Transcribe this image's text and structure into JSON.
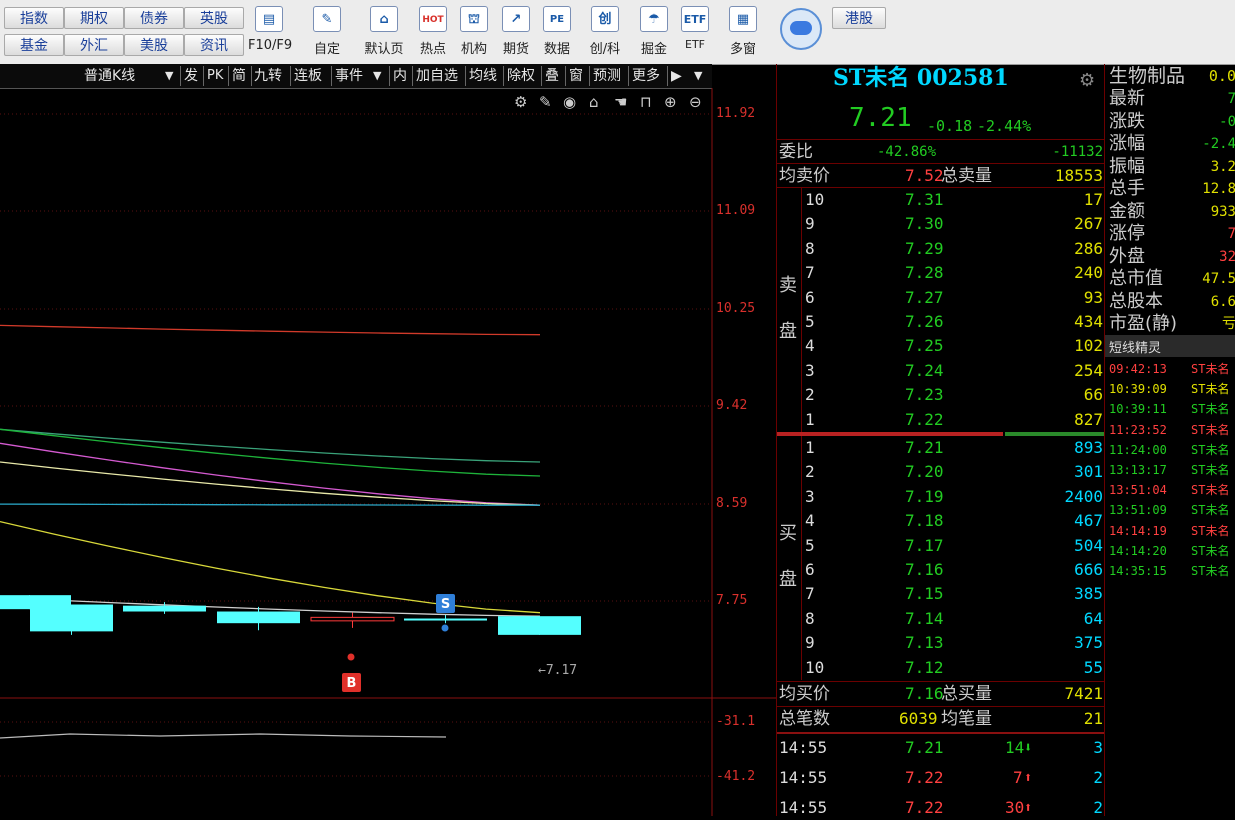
{
  "toolbar": {
    "text_buttons": [
      "指数",
      "期权",
      "债券",
      "英股",
      "基金",
      "外汇",
      "美股",
      "资讯"
    ],
    "icon_buttons": [
      {
        "label": "F10/F9",
        "icon": "f10-icon"
      },
      {
        "label": "自定",
        "icon": "custom-icon"
      },
      {
        "label": "默认页",
        "icon": "home-l2-icon"
      },
      {
        "label": "热点",
        "icon": "hot-icon",
        "glyph": "HOT"
      },
      {
        "label": "机构",
        "icon": "institution-icon"
      },
      {
        "label": "期货",
        "icon": "futures-icon"
      },
      {
        "label": "数据",
        "icon": "pe-data-icon",
        "glyph": "PE"
      },
      {
        "label": "创/科",
        "icon": "chuang-icon",
        "glyph": "创"
      },
      {
        "label": "掘金",
        "icon": "dig-gold-icon"
      },
      {
        "label": "ETF",
        "icon": "etf-icon",
        "glyph": "ETF"
      },
      {
        "label": "多窗",
        "icon": "multi-window-icon"
      }
    ],
    "hk_button": "港股"
  },
  "chart_toolbar": {
    "items": [
      "普通K线",
      "发",
      "PK",
      "简",
      "九转",
      "连板",
      "事件",
      "内",
      "加自选",
      "均线",
      "除权",
      "叠",
      "窗",
      "预测",
      "更多"
    ]
  },
  "chart_data": {
    "type": "candlestick",
    "y_ticks": [
      "11.92",
      "11.09",
      "10.25",
      "9.42",
      "8.59",
      "7.75"
    ],
    "indicator_ticks": [
      "-31.1",
      "-41.2"
    ],
    "last_price_label": "←7.17",
    "markers": [
      "S",
      "B"
    ],
    "ylim": [
      7.0,
      12.0
    ],
    "candles": [
      {
        "open": 7.8,
        "close": 7.68,
        "high": 7.8,
        "low": 7.68
      },
      {
        "open": 7.72,
        "close": 7.49,
        "high": 7.72,
        "low": 7.46
      },
      {
        "open": 7.71,
        "close": 7.66,
        "high": 7.74,
        "low": 7.64
      },
      {
        "open": 7.66,
        "close": 7.56,
        "high": 7.7,
        "low": 7.5
      },
      {
        "open": 7.58,
        "close": 7.61,
        "high": 7.65,
        "low": 7.52
      },
      {
        "open": 7.6,
        "close": 7.59,
        "high": 7.63,
        "low": 7.56
      },
      {
        "open": 7.62,
        "close": 7.46,
        "high": 7.62,
        "low": 7.46
      }
    ],
    "ma_lines": [
      {
        "color": "#d13a2a",
        "from": 10.11,
        "to": 10.03
      },
      {
        "color": "#3aa37a",
        "from": 9.22,
        "to": 8.94
      },
      {
        "color": "#1eb33a",
        "from": 9.22,
        "to": 8.82
      },
      {
        "color": "#d45ad0",
        "from": 9.1,
        "to": 8.57
      },
      {
        "color": "#e9e9a9",
        "from": 8.94,
        "to": 8.57
      },
      {
        "color": "#2aa8c8",
        "from": 8.58,
        "to": 8.57
      },
      {
        "color": "#d8d83a",
        "from": 8.43,
        "to": 7.65
      },
      {
        "color": "#cfcfcf",
        "from": 7.78,
        "to": 7.62
      }
    ]
  },
  "quote": {
    "name": "ST未名 002581",
    "price": "7.21",
    "change": "-0.18",
    "change_pct": "-2.44%",
    "weibi_label": "委比",
    "weibi_pct": "-42.86%",
    "weibi_diff": "-11132",
    "avg_sell_label": "均卖价",
    "avg_sell": "7.52",
    "total_sell_label": "总卖量",
    "total_sell": "18553",
    "sell_side_label": [
      "卖",
      "盘"
    ],
    "buy_side_label": [
      "买",
      "盘"
    ],
    "sells": [
      {
        "lvl": "10",
        "price": "7.31",
        "vol": "17"
      },
      {
        "lvl": "9",
        "price": "7.30",
        "vol": "267"
      },
      {
        "lvl": "8",
        "price": "7.29",
        "vol": "286"
      },
      {
        "lvl": "7",
        "price": "7.28",
        "vol": "240"
      },
      {
        "lvl": "6",
        "price": "7.27",
        "vol": "93"
      },
      {
        "lvl": "5",
        "price": "7.26",
        "vol": "434"
      },
      {
        "lvl": "4",
        "price": "7.25",
        "vol": "102"
      },
      {
        "lvl": "3",
        "price": "7.24",
        "vol": "254"
      },
      {
        "lvl": "2",
        "price": "7.23",
        "vol": "66"
      },
      {
        "lvl": "1",
        "price": "7.22",
        "vol": "827"
      }
    ],
    "buys": [
      {
        "lvl": "1",
        "price": "7.21",
        "vol": "893"
      },
      {
        "lvl": "2",
        "price": "7.20",
        "vol": "301"
      },
      {
        "lvl": "3",
        "price": "7.19",
        "vol": "2400"
      },
      {
        "lvl": "4",
        "price": "7.18",
        "vol": "467"
      },
      {
        "lvl": "5",
        "price": "7.17",
        "vol": "504"
      },
      {
        "lvl": "6",
        "price": "7.16",
        "vol": "666"
      },
      {
        "lvl": "7",
        "price": "7.15",
        "vol": "385"
      },
      {
        "lvl": "8",
        "price": "7.14",
        "vol": "64"
      },
      {
        "lvl": "9",
        "price": "7.13",
        "vol": "375"
      },
      {
        "lvl": "10",
        "price": "7.12",
        "vol": "55"
      }
    ],
    "avg_buy_label": "均买价",
    "avg_buy": "7.16",
    "total_buy_label": "总买量",
    "total_buy": "7421",
    "total_trades_label": "总笔数",
    "total_trades": "6039",
    "avg_trade_label": "均笔量",
    "avg_trade": "21",
    "ticks": [
      {
        "time": "14:55",
        "price": "7.21",
        "vol": "14",
        "dir": "down",
        "n": "3"
      },
      {
        "time": "14:55",
        "price": "7.22",
        "vol": "7",
        "dir": "up",
        "n": "2"
      },
      {
        "time": "14:55",
        "price": "7.22",
        "vol": "30",
        "dir": "up",
        "n": "2"
      }
    ]
  },
  "side_panel": {
    "industry": "生物制品",
    "industry_val": "0.0",
    "fields": [
      {
        "label": "最新",
        "value": "7",
        "color": "#22cc22"
      },
      {
        "label": "涨跌",
        "value": "-0",
        "color": "#22cc22"
      },
      {
        "label": "涨幅",
        "value": "-2.4",
        "color": "#22cc22"
      },
      {
        "label": "振幅",
        "value": "3.2",
        "color": "#e0e000"
      },
      {
        "label": "总手",
        "value": "12.8",
        "color": "#e0e000"
      },
      {
        "label": "金额",
        "value": "933",
        "color": "#e0e000"
      },
      {
        "label": "涨停",
        "value": "7",
        "color": "#ff4040"
      },
      {
        "label": "外盘",
        "value": "32",
        "color": "#ff4040"
      },
      {
        "label": "总市值",
        "value": "47.5",
        "color": "#e0e000"
      },
      {
        "label": "总股本",
        "value": "6.6",
        "color": "#e0e000"
      },
      {
        "label": "市盈(静)",
        "value": "亏",
        "color": "#e0e000"
      }
    ],
    "sprite_title": "短线精灵",
    "signals": [
      {
        "time": "09:42:13",
        "name": "ST未名",
        "color": "#ff4040"
      },
      {
        "time": "10:39:09",
        "name": "ST未名",
        "color": "#e0e000"
      },
      {
        "time": "10:39:11",
        "name": "ST未名",
        "color": "#22cc22"
      },
      {
        "time": "11:23:52",
        "name": "ST未名",
        "color": "#ff4040"
      },
      {
        "time": "11:24:00",
        "name": "ST未名",
        "color": "#22cc22"
      },
      {
        "time": "13:13:17",
        "name": "ST未名",
        "color": "#22cc22"
      },
      {
        "time": "13:51:04",
        "name": "ST未名",
        "color": "#ff4040"
      },
      {
        "time": "13:51:09",
        "name": "ST未名",
        "color": "#22cc22"
      },
      {
        "time": "14:14:19",
        "name": "ST未名",
        "color": "#ff4040"
      },
      {
        "time": "14:14:20",
        "name": "ST未名",
        "color": "#22cc22"
      },
      {
        "time": "14:35:15",
        "name": "ST未名",
        "color": "#22cc22"
      }
    ]
  }
}
